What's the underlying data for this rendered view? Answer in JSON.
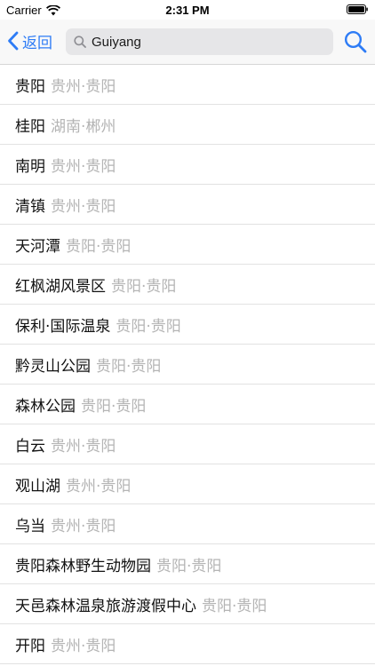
{
  "status_bar": {
    "carrier": "Carrier",
    "time": "2:31 PM"
  },
  "nav": {
    "back_label": "返回",
    "search_value": "Guiyang"
  },
  "results": [
    {
      "name": "贵阳",
      "region": "贵州·贵阳"
    },
    {
      "name": "桂阳",
      "region": "湖南·郴州"
    },
    {
      "name": "南明",
      "region": "贵州·贵阳"
    },
    {
      "name": "清镇",
      "region": "贵州·贵阳"
    },
    {
      "name": "天河潭",
      "region": "贵阳·贵阳"
    },
    {
      "name": "红枫湖风景区",
      "region": "贵阳·贵阳"
    },
    {
      "name": "保利·国际温泉",
      "region": "贵阳·贵阳"
    },
    {
      "name": "黔灵山公园",
      "region": "贵阳·贵阳"
    },
    {
      "name": "森林公园",
      "region": "贵阳·贵阳"
    },
    {
      "name": "白云",
      "region": "贵州·贵阳"
    },
    {
      "name": "观山湖",
      "region": "贵州·贵阳"
    },
    {
      "name": "乌当",
      "region": "贵州·贵阳"
    },
    {
      "name": "贵阳森林野生动物园",
      "region": "贵阳·贵阳"
    },
    {
      "name": "天邑森林温泉旅游渡假中心",
      "region": "贵阳·贵阳"
    },
    {
      "name": "开阳",
      "region": "贵州·贵阳"
    }
  ],
  "colors": {
    "accent": "#2e7cf6",
    "secondary_text": "#b4b4b4"
  },
  "icons": {
    "back": "chevron-left-icon",
    "search_field": "search-icon",
    "search_button": "search-icon",
    "wifi": "wifi-icon",
    "battery": "battery-icon"
  }
}
